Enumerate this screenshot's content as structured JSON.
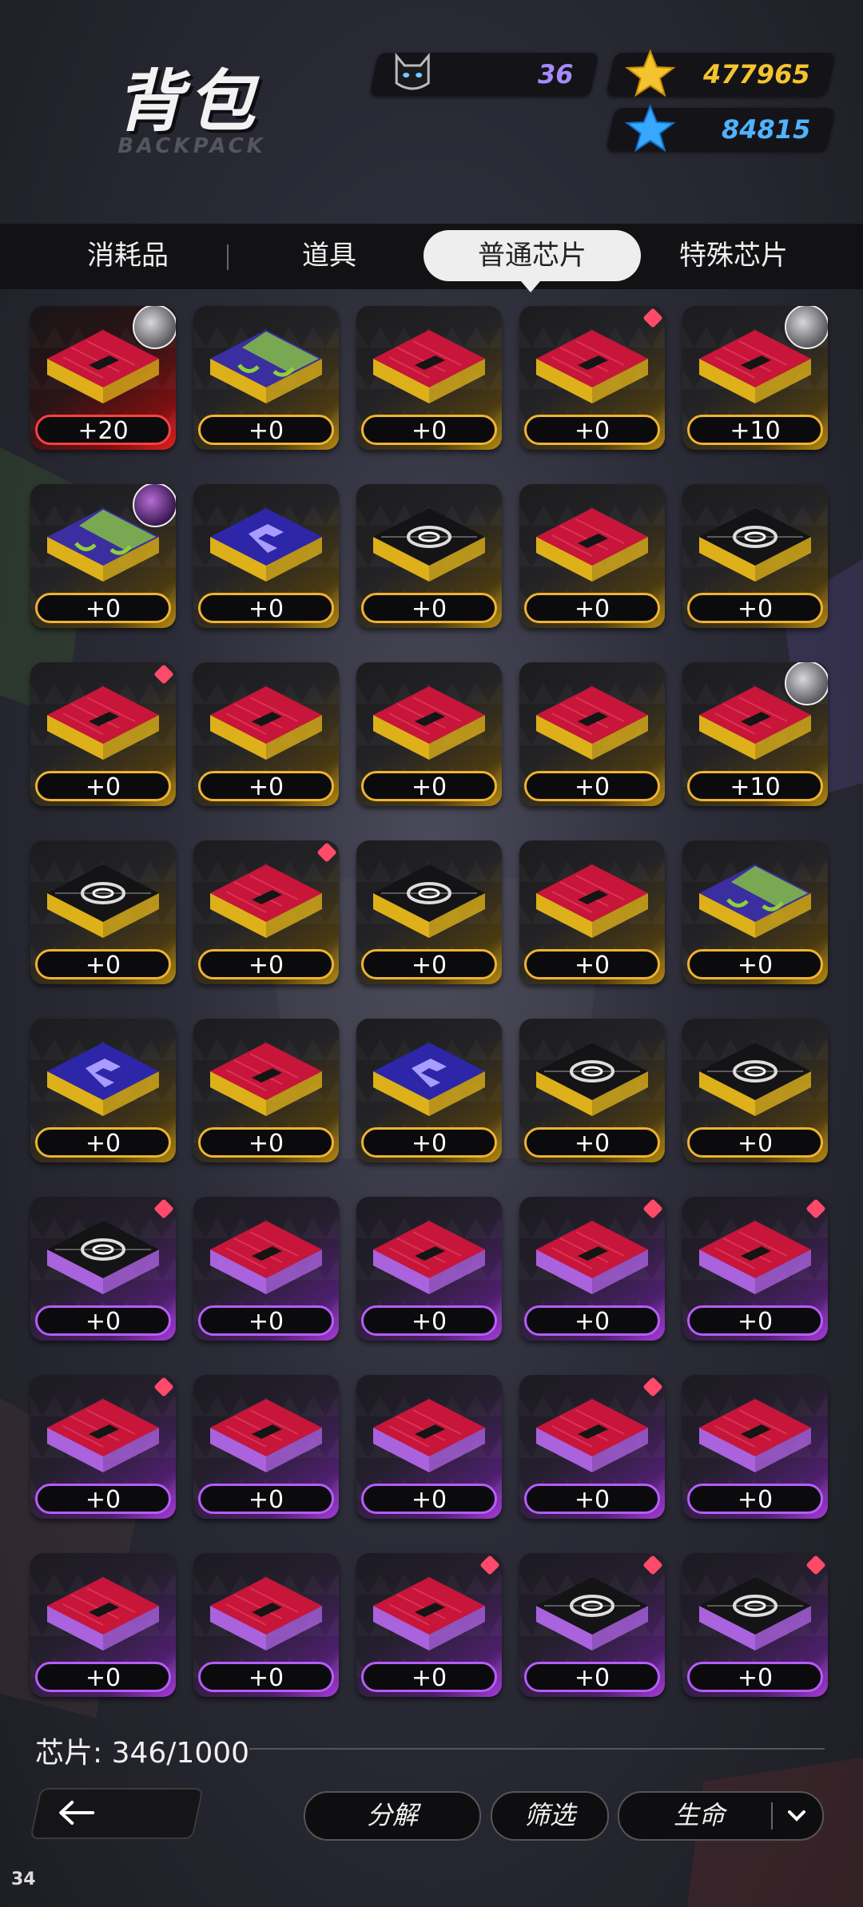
{
  "header": {
    "title": "背包",
    "subtitle": "BACKPACK",
    "currencies": [
      {
        "icon": "cat-token-icon",
        "value": "36",
        "color": "#a78bfa"
      },
      {
        "icon": "gold-star-icon",
        "value": "477965",
        "color": "#f4c430"
      },
      {
        "icon": "blue-star-icon",
        "value": "84815",
        "color": "#4fb3ff"
      }
    ]
  },
  "tabs": [
    {
      "label": "消耗品",
      "active": false
    },
    {
      "label": "道具",
      "active": false
    },
    {
      "label": "普通芯片",
      "active": true
    },
    {
      "label": "特殊芯片",
      "active": false
    }
  ],
  "chips": [
    {
      "rarity": "red",
      "design": "red-bolt",
      "level": "+20",
      "badge": "avatar"
    },
    {
      "rarity": "gold",
      "design": "green-mesh",
      "level": "+0",
      "badge": ""
    },
    {
      "rarity": "gold",
      "design": "red-bolt",
      "level": "+0",
      "badge": ""
    },
    {
      "rarity": "gold",
      "design": "red-bolt",
      "level": "+0",
      "badge": "dot"
    },
    {
      "rarity": "gold",
      "design": "red-bolt",
      "level": "+10",
      "badge": "avatar"
    },
    {
      "rarity": "gold",
      "design": "green-mesh",
      "level": "+0",
      "badge": "avatar-dark"
    },
    {
      "rarity": "gold",
      "design": "blue-logo",
      "level": "+0",
      "badge": ""
    },
    {
      "rarity": "gold",
      "design": "swirl",
      "level": "+0",
      "badge": ""
    },
    {
      "rarity": "gold",
      "design": "red-bolt",
      "level": "+0",
      "badge": ""
    },
    {
      "rarity": "gold",
      "design": "swirl",
      "level": "+0",
      "badge": ""
    },
    {
      "rarity": "gold",
      "design": "red-bolt",
      "level": "+0",
      "badge": "dot"
    },
    {
      "rarity": "gold",
      "design": "red-bolt",
      "level": "+0",
      "badge": ""
    },
    {
      "rarity": "gold",
      "design": "red-bolt",
      "level": "+0",
      "badge": ""
    },
    {
      "rarity": "gold",
      "design": "red-bolt",
      "level": "+0",
      "badge": ""
    },
    {
      "rarity": "gold",
      "design": "red-bolt",
      "level": "+10",
      "badge": "avatar"
    },
    {
      "rarity": "gold",
      "design": "swirl",
      "level": "+0",
      "badge": ""
    },
    {
      "rarity": "gold",
      "design": "red-bolt",
      "level": "+0",
      "badge": "dot"
    },
    {
      "rarity": "gold",
      "design": "swirl",
      "level": "+0",
      "badge": ""
    },
    {
      "rarity": "gold",
      "design": "red-bolt",
      "level": "+0",
      "badge": ""
    },
    {
      "rarity": "gold",
      "design": "green-mesh",
      "level": "+0",
      "badge": ""
    },
    {
      "rarity": "gold",
      "design": "blue-logo",
      "level": "+0",
      "badge": ""
    },
    {
      "rarity": "gold",
      "design": "red-bolt",
      "level": "+0",
      "badge": ""
    },
    {
      "rarity": "gold",
      "design": "blue-logo",
      "level": "+0",
      "badge": ""
    },
    {
      "rarity": "gold",
      "design": "swirl",
      "level": "+0",
      "badge": ""
    },
    {
      "rarity": "gold",
      "design": "swirl",
      "level": "+0",
      "badge": ""
    },
    {
      "rarity": "purple",
      "design": "swirl",
      "level": "+0",
      "badge": "dot"
    },
    {
      "rarity": "purple",
      "design": "red-bolt",
      "level": "+0",
      "badge": ""
    },
    {
      "rarity": "purple",
      "design": "red-bolt",
      "level": "+0",
      "badge": ""
    },
    {
      "rarity": "purple",
      "design": "red-bolt",
      "level": "+0",
      "badge": "dot"
    },
    {
      "rarity": "purple",
      "design": "red-bolt",
      "level": "+0",
      "badge": "dot"
    },
    {
      "rarity": "purple",
      "design": "red-bolt",
      "level": "+0",
      "badge": "dot"
    },
    {
      "rarity": "purple",
      "design": "red-bolt",
      "level": "+0",
      "badge": ""
    },
    {
      "rarity": "purple",
      "design": "red-bolt",
      "level": "+0",
      "badge": ""
    },
    {
      "rarity": "purple",
      "design": "red-bolt",
      "level": "+0",
      "badge": "dot"
    },
    {
      "rarity": "purple",
      "design": "red-bolt",
      "level": "+0",
      "badge": ""
    },
    {
      "rarity": "purple",
      "design": "red-bolt",
      "level": "+0",
      "badge": ""
    },
    {
      "rarity": "purple",
      "design": "red-bolt",
      "level": "+0",
      "badge": ""
    },
    {
      "rarity": "purple",
      "design": "red-bolt",
      "level": "+0",
      "badge": "dot"
    },
    {
      "rarity": "purple",
      "design": "swirl",
      "level": "+0",
      "badge": "dot"
    },
    {
      "rarity": "purple",
      "design": "swirl",
      "level": "+0",
      "badge": "dot"
    }
  ],
  "footer": {
    "capacity_label": "芯片: 346/1000",
    "decompose_label": "分解",
    "filter_label": "筛选",
    "sort_value": "生命"
  },
  "debug": {
    "fps": "34"
  }
}
